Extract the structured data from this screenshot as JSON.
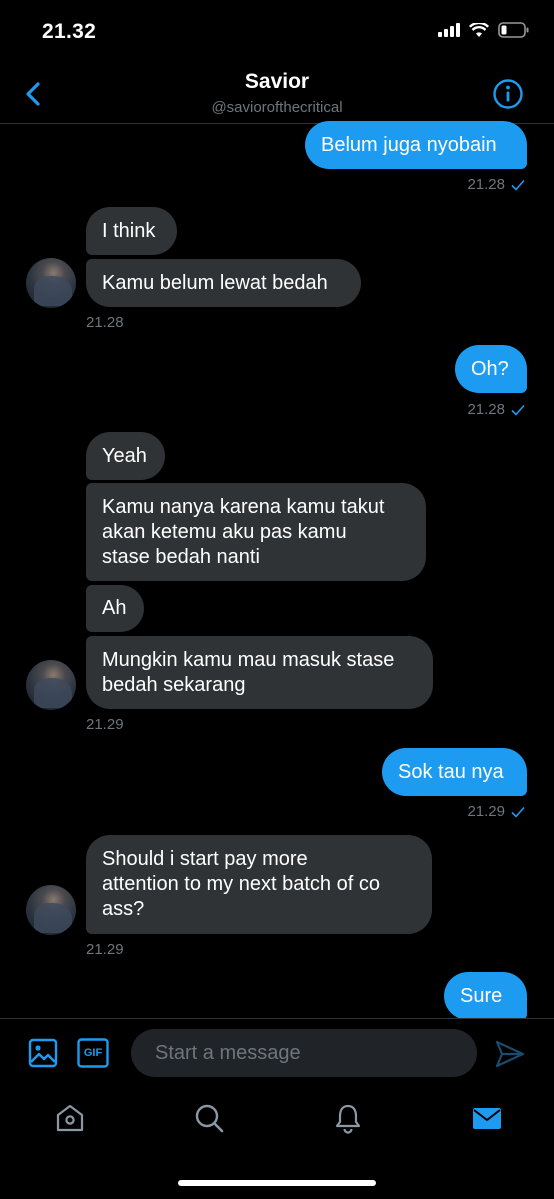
{
  "status_bar": {
    "time": "21.32"
  },
  "header": {
    "title": "Savior",
    "handle": "@saviorofthecritical"
  },
  "messages": {
    "m1": "Belum juga nyobain",
    "t1": "21.28",
    "m2": "I think",
    "m3": "Kamu belum lewat bedah",
    "t2": "21.28",
    "m4": "Oh?",
    "t3": "21.28",
    "m5": "Yeah",
    "m6": "Kamu nanya karena kamu takut\nakan ketemu aku pas kamu\nstase bedah nanti",
    "m7": "Ah",
    "m8": "Mungkin kamu mau masuk stase\nbedah sekarang",
    "t4": "21.29",
    "m9": "Sok tau nya",
    "t5": "21.29",
    "m10": "Should i start pay more\nattention to my next batch of co\nass?",
    "t6": "21.29",
    "m11": "Sure"
  },
  "composer": {
    "placeholder": "Start a message",
    "gif_label": "GIF"
  },
  "colors": {
    "accent": "#1d9bf0",
    "received_bubble": "#2f3336",
    "muted": "#6e767d"
  },
  "icons": {
    "back": "chevron-left-icon",
    "info": "info-icon",
    "image": "image-icon",
    "gif": "gif-icon",
    "send": "send-icon",
    "home": "home-icon",
    "search": "search-icon",
    "notifications": "bell-icon",
    "messages": "mail-icon"
  }
}
